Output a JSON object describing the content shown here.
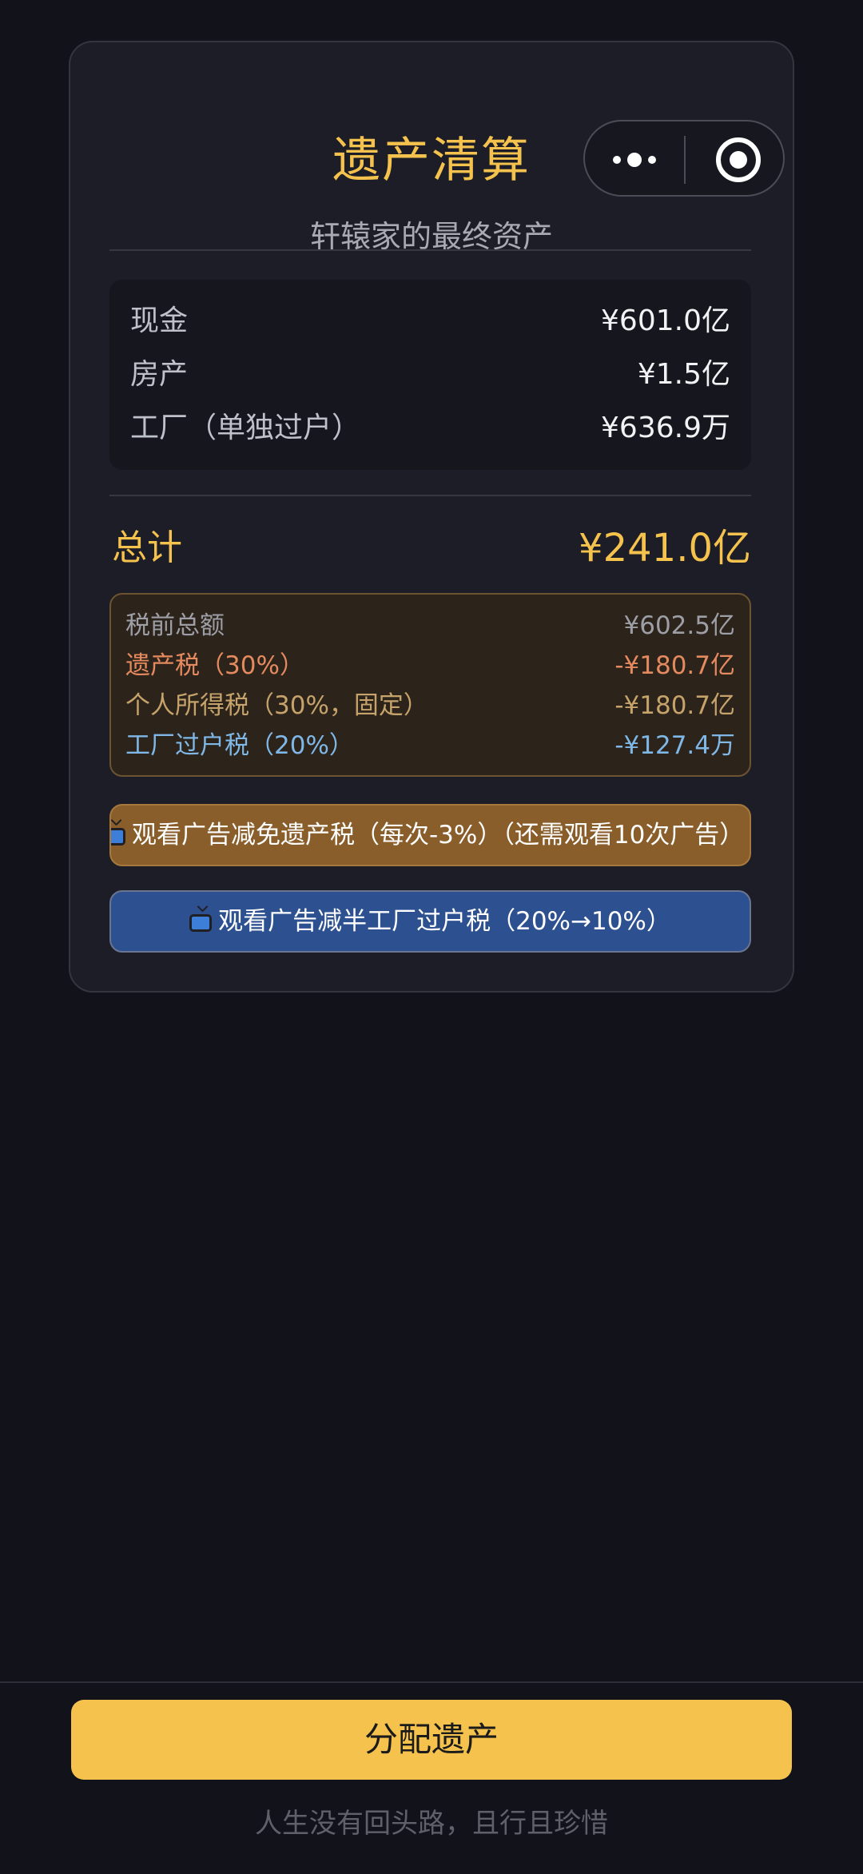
{
  "card": {
    "title": "遗产清算",
    "subtitle": "轩辕家的最终资产"
  },
  "capsule": {
    "more_icon": "more-dots-icon",
    "close_icon": "close-circle-icon"
  },
  "assets": [
    {
      "label": "现金",
      "value": "¥601.0亿"
    },
    {
      "label": "房产",
      "value": "¥1.5亿"
    },
    {
      "label": "工厂（单独过户）",
      "value": "¥636.9万"
    }
  ],
  "total": {
    "label": "总计",
    "value": "¥241.0亿"
  },
  "taxes": [
    {
      "label": "税前总额",
      "value": "¥602.5亿"
    },
    {
      "label": "遗产税（30%）",
      "value": "-¥180.7亿"
    },
    {
      "label": "个人所得税（30%，固定）",
      "value": "-¥180.7亿"
    },
    {
      "label": "工厂过户税（20%）",
      "value": "-¥127.4万"
    }
  ],
  "ad_buttons": {
    "inheritance": "观看广告减免遗产税（每次-3%）（还需观看10次广告）",
    "factory": "观看广告减半工厂过户税（20%→10%）",
    "icon": "tv-icon"
  },
  "actions": {
    "distribute_label": "分配遗产",
    "footer_note": "人生没有回头路，且行且珍惜"
  },
  "colors": {
    "background": "#12121b",
    "card": "#1c1d27",
    "accent_gold": "#f4c24d",
    "tax_orange": "#e58a5e",
    "tax_blue": "#7fb7e6",
    "ad_orange": "#8a5e2b",
    "ad_blue": "#2d5190"
  }
}
